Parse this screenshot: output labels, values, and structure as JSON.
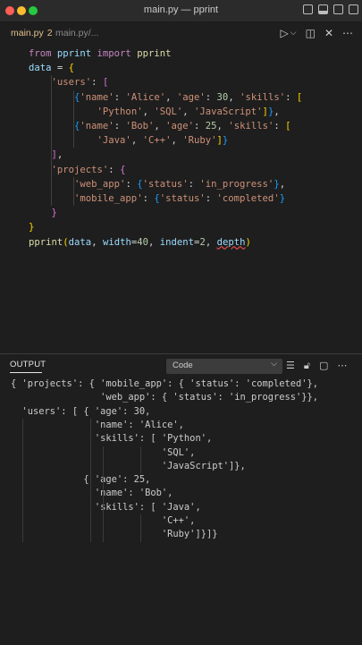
{
  "window": {
    "title": "main.py — pprint"
  },
  "tab": {
    "file": "main.py",
    "problems": "2",
    "path": "main.py/..."
  },
  "editor": {
    "lines": [
      [
        {
          "t": "from ",
          "c": "kw"
        },
        {
          "t": "pprint ",
          "c": "var"
        },
        {
          "t": "import ",
          "c": "kw"
        },
        {
          "t": "pprint",
          "c": "fn"
        }
      ],
      [
        {
          "t": "data",
          "c": "var"
        },
        {
          "t": " = ",
          "c": "op"
        },
        {
          "t": "{",
          "c": "br1"
        }
      ],
      [
        {
          "t": "    ",
          "c": "op"
        },
        {
          "t": "'users'",
          "c": "str"
        },
        {
          "t": ": ",
          "c": "op"
        },
        {
          "t": "[",
          "c": "br2"
        }
      ],
      [
        {
          "t": "        ",
          "c": "op"
        },
        {
          "t": "{",
          "c": "br3"
        },
        {
          "t": "'name'",
          "c": "str"
        },
        {
          "t": ": ",
          "c": "op"
        },
        {
          "t": "'Alice'",
          "c": "str"
        },
        {
          "t": ", ",
          "c": "op"
        },
        {
          "t": "'age'",
          "c": "str"
        },
        {
          "t": ": ",
          "c": "op"
        },
        {
          "t": "30",
          "c": "num"
        },
        {
          "t": ", ",
          "c": "op"
        },
        {
          "t": "'skills'",
          "c": "str"
        },
        {
          "t": ": ",
          "c": "op"
        },
        {
          "t": "[",
          "c": "br1"
        }
      ],
      [
        {
          "t": "            ",
          "c": "op"
        },
        {
          "t": "'Python'",
          "c": "str"
        },
        {
          "t": ", ",
          "c": "op"
        },
        {
          "t": "'SQL'",
          "c": "str"
        },
        {
          "t": ", ",
          "c": "op"
        },
        {
          "t": "'JavaScript'",
          "c": "str"
        },
        {
          "t": "]",
          "c": "br1"
        },
        {
          "t": "}",
          "c": "br3"
        },
        {
          "t": ",",
          "c": "op"
        }
      ],
      [
        {
          "t": "        ",
          "c": "op"
        },
        {
          "t": "{",
          "c": "br3"
        },
        {
          "t": "'name'",
          "c": "str"
        },
        {
          "t": ": ",
          "c": "op"
        },
        {
          "t": "'Bob'",
          "c": "str"
        },
        {
          "t": ", ",
          "c": "op"
        },
        {
          "t": "'age'",
          "c": "str"
        },
        {
          "t": ": ",
          "c": "op"
        },
        {
          "t": "25",
          "c": "num"
        },
        {
          "t": ", ",
          "c": "op"
        },
        {
          "t": "'skills'",
          "c": "str"
        },
        {
          "t": ": ",
          "c": "op"
        },
        {
          "t": "[",
          "c": "br1"
        }
      ],
      [
        {
          "t": "            ",
          "c": "op"
        },
        {
          "t": "'Java'",
          "c": "str"
        },
        {
          "t": ", ",
          "c": "op"
        },
        {
          "t": "'C++'",
          "c": "str"
        },
        {
          "t": ", ",
          "c": "op"
        },
        {
          "t": "'Ruby'",
          "c": "str"
        },
        {
          "t": "]",
          "c": "br1"
        },
        {
          "t": "}",
          "c": "br3"
        }
      ],
      [
        {
          "t": "    ",
          "c": "op"
        },
        {
          "t": "]",
          "c": "br2"
        },
        {
          "t": ",",
          "c": "op"
        }
      ],
      [
        {
          "t": "    ",
          "c": "op"
        },
        {
          "t": "'projects'",
          "c": "str"
        },
        {
          "t": ": ",
          "c": "op"
        },
        {
          "t": "{",
          "c": "br2"
        }
      ],
      [
        {
          "t": "        ",
          "c": "op"
        },
        {
          "t": "'web_app'",
          "c": "str"
        },
        {
          "t": ": ",
          "c": "op"
        },
        {
          "t": "{",
          "c": "br3"
        },
        {
          "t": "'status'",
          "c": "str"
        },
        {
          "t": ": ",
          "c": "op"
        },
        {
          "t": "'in_progress'",
          "c": "str"
        },
        {
          "t": "}",
          "c": "br3"
        },
        {
          "t": ",",
          "c": "op"
        }
      ],
      [
        {
          "t": "        ",
          "c": "op"
        },
        {
          "t": "'mobile_app'",
          "c": "str"
        },
        {
          "t": ": ",
          "c": "op"
        },
        {
          "t": "{",
          "c": "br3"
        },
        {
          "t": "'status'",
          "c": "str"
        },
        {
          "t": ": ",
          "c": "op"
        },
        {
          "t": "'completed'",
          "c": "str"
        },
        {
          "t": "}",
          "c": "br3"
        }
      ],
      [
        {
          "t": "    ",
          "c": "op"
        },
        {
          "t": "}",
          "c": "br2"
        }
      ],
      [
        {
          "t": "}",
          "c": "br1"
        }
      ],
      [
        {
          "t": "pprint",
          "c": "fn"
        },
        {
          "t": "(",
          "c": "br1"
        },
        {
          "t": "data",
          "c": "var"
        },
        {
          "t": ", ",
          "c": "op"
        },
        {
          "t": "width",
          "c": "var"
        },
        {
          "t": "=",
          "c": "op"
        },
        {
          "t": "40",
          "c": "num"
        },
        {
          "t": ", ",
          "c": "op"
        },
        {
          "t": "indent",
          "c": "var"
        },
        {
          "t": "=",
          "c": "op"
        },
        {
          "t": "2",
          "c": "num"
        },
        {
          "t": ", ",
          "c": "op"
        },
        {
          "t": "depth",
          "c": "var squiggle"
        },
        {
          "t": ")",
          "c": "br1"
        }
      ]
    ]
  },
  "panel": {
    "title": "OUTPUT",
    "channel": "Code",
    "lines": [
      "{ 'projects': { 'mobile_app': { 'status': 'completed'},",
      "                'web_app': { 'status': 'in_progress'}},",
      "  'users': [ { 'age': 30,",
      "               'name': 'Alice',",
      "               'skills': [ 'Python',",
      "                           'SQL',",
      "                           'JavaScript']},",
      "             { 'age': 25,",
      "               'name': 'Bob',",
      "               'skills': [ 'Java',",
      "                           'C++',",
      "                           'Ruby']}]}"
    ]
  }
}
